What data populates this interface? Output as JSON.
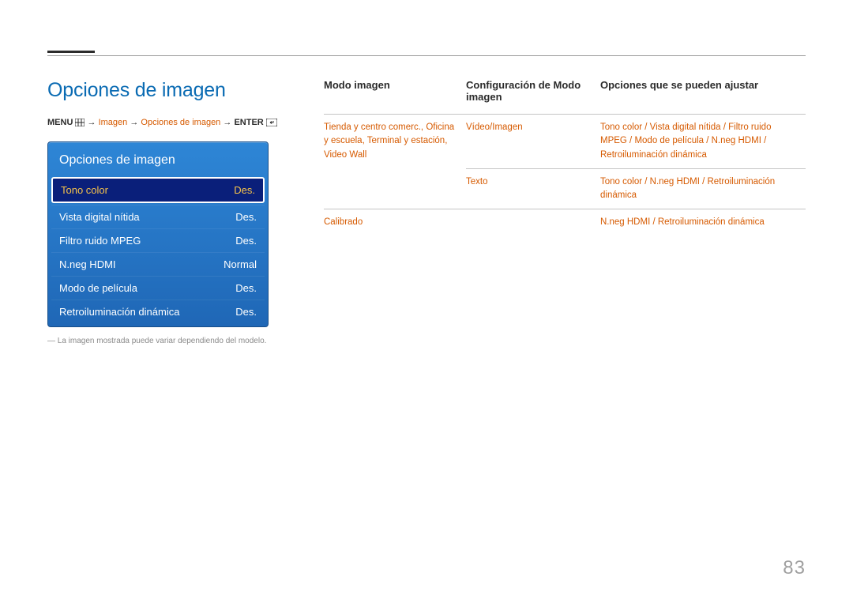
{
  "page_number": "83",
  "section_title": "Opciones de imagen",
  "breadcrumb": {
    "menu": "MENU",
    "arrow": "→",
    "p1": "Imagen",
    "p2": "Opciones de imagen",
    "enter": "ENTER"
  },
  "osd": {
    "title": "Opciones de imagen",
    "rows": [
      {
        "label": "Tono color",
        "value": "Des.",
        "selected": true
      },
      {
        "label": "Vista digital nítida",
        "value": "Des.",
        "selected": false
      },
      {
        "label": "Filtro ruido MPEG",
        "value": "Des.",
        "selected": false
      },
      {
        "label": "N.neg HDMI",
        "value": "Normal",
        "selected": false
      },
      {
        "label": "Modo de película",
        "value": "Des.",
        "selected": false
      },
      {
        "label": "Retroiluminación dinámica",
        "value": "Des.",
        "selected": false
      }
    ]
  },
  "footnote": "La imagen mostrada puede variar dependiendo del modelo.",
  "table": {
    "headers": {
      "mode": "Modo imagen",
      "cfg": "Configuración de Modo imagen",
      "opts": "Opciones que se pueden ajustar"
    },
    "rows": [
      {
        "mode": "Tienda y centro comerc., Oficina y escuela, Terminal y estación, Video Wall",
        "cfg": "Vídeo/Imagen",
        "opts": "Tono color / Vista digital nítida / Filtro ruido MPEG / Modo de película / N.neg HDMI / Retroiluminación dinámica"
      },
      {
        "mode": "",
        "cfg": "Texto",
        "opts": "Tono color / N.neg HDMI / Retroiluminación dinámica"
      },
      {
        "mode": "Calibrado",
        "cfg": "",
        "opts": "N.neg HDMI / Retroiluminación dinámica"
      }
    ]
  }
}
